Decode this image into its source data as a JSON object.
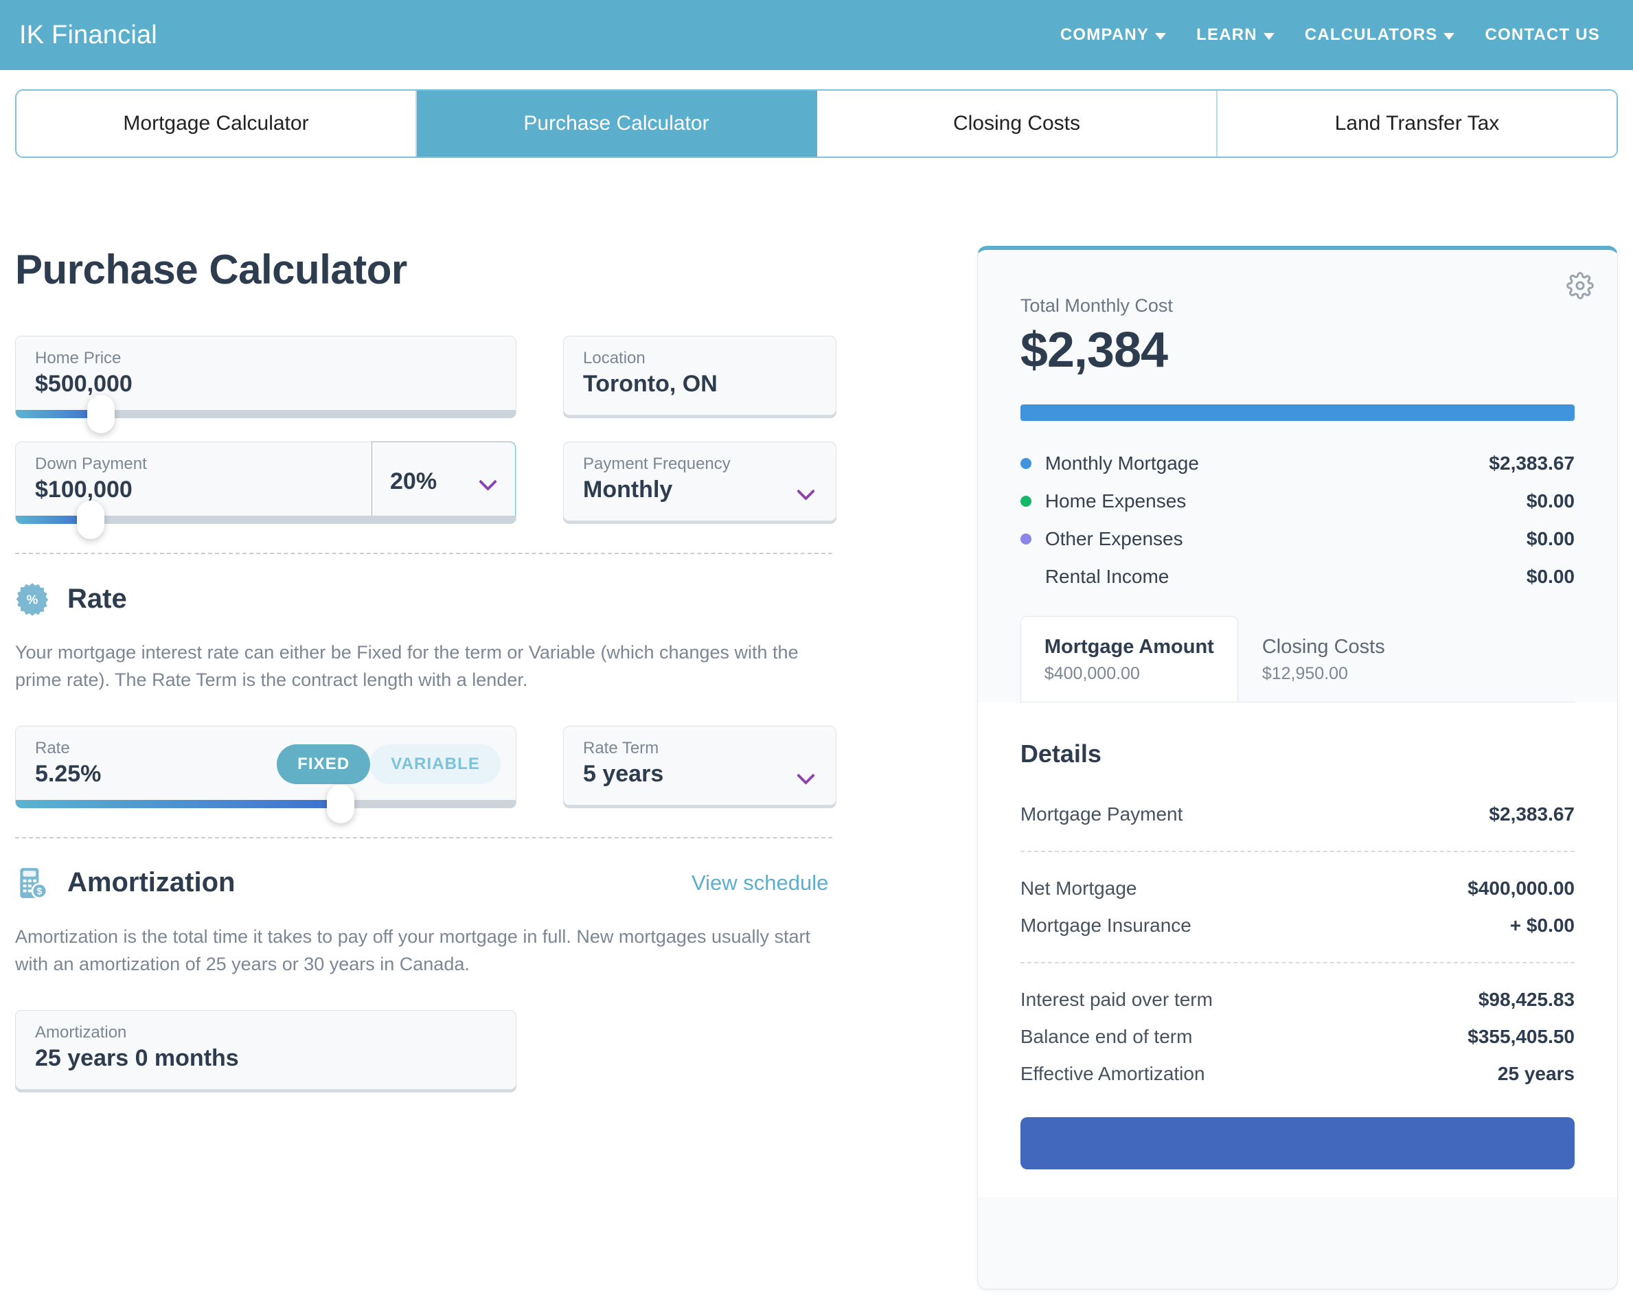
{
  "header": {
    "brand": "IK Financial",
    "nav": [
      {
        "label": "COMPANY",
        "has_dropdown": true
      },
      {
        "label": "LEARN",
        "has_dropdown": true
      },
      {
        "label": "CALCULATORS",
        "has_dropdown": true
      },
      {
        "label": "CONTACT US",
        "has_dropdown": false
      }
    ],
    "bg_color": "#5bafcc"
  },
  "tabs": [
    {
      "label": "Mortgage Calculator",
      "active": false
    },
    {
      "label": "Purchase Calculator",
      "active": true
    },
    {
      "label": "Closing Costs",
      "active": false
    },
    {
      "label": "Land Transfer Tax",
      "active": false
    }
  ],
  "page": {
    "title": "Purchase Calculator"
  },
  "inputs": {
    "home_price": {
      "label": "Home Price",
      "value": "$500,000",
      "slider_pct": 17
    },
    "location": {
      "label": "Location",
      "value": "Toronto, ON"
    },
    "down_payment": {
      "label": "Down Payment",
      "value": "$100,000",
      "slider_pct": 21,
      "percent_value": "20%"
    },
    "payment_frequency": {
      "label": "Payment Frequency",
      "value": "Monthly"
    }
  },
  "rate_section": {
    "title": "Rate",
    "icon": "percent-badge-icon",
    "description": "Your mortgage interest rate can either be Fixed for the term or Variable (which changes with the prime rate). The Rate Term is the contract length with a lender.",
    "rate_field": {
      "label": "Rate",
      "value": "5.25%",
      "slider_pct": 65
    },
    "toggle": {
      "fixed_label": "FIXED",
      "variable_label": "VARIABLE",
      "selected": "FIXED"
    },
    "rate_term": {
      "label": "Rate Term",
      "value": "5 years"
    }
  },
  "amortization_section": {
    "title": "Amortization",
    "icon": "calculator-dollar-icon",
    "link_label": "View schedule",
    "description": "Amortization is the total time it takes to pay off your mortgage in full. New mortgages usually start with an amortization of 25 years or 30 years in Canada.",
    "field": {
      "label": "Amortization",
      "value": "25 years   0 months"
    }
  },
  "results": {
    "total_label": "Total Monthly Cost",
    "total_value": "$2,384",
    "bar_color": "#4094de",
    "breakdown": [
      {
        "label": "Monthly Mortgage",
        "amount": "$2,383.67",
        "color": "#4094de"
      },
      {
        "label": "Home Expenses",
        "amount": "$0.00",
        "color": "#15b866"
      },
      {
        "label": "Other Expenses",
        "amount": "$0.00",
        "color": "#8b87e8"
      },
      {
        "label": "Rental Income",
        "amount": "$0.00",
        "color": ""
      }
    ],
    "inner_tabs": [
      {
        "title": "Mortgage Amount",
        "sub": "$400,000.00",
        "selected": true
      },
      {
        "title": "Closing Costs",
        "sub": "$12,950.00",
        "selected": false
      }
    ],
    "details_title": "Details",
    "details_group_1": [
      {
        "label": "Mortgage Payment",
        "amount": "$2,383.67"
      }
    ],
    "details_group_2": [
      {
        "label": "Net Mortgage",
        "amount": "$400,000.00"
      },
      {
        "label": "Mortgage Insurance",
        "amount": "+ $0.00"
      }
    ],
    "details_group_3": [
      {
        "label": "Interest paid over term",
        "amount": "$98,425.83"
      },
      {
        "label": "Balance end of term",
        "amount": "$355,405.50"
      },
      {
        "label": "Effective Amortization",
        "amount": "25 years"
      }
    ],
    "settings_icon": "gear-icon",
    "cta_color": "#4268bd"
  }
}
